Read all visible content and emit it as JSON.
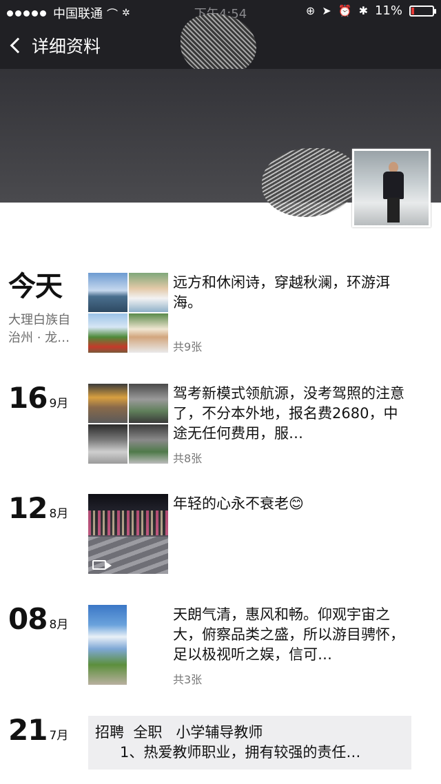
{
  "status_bar": {
    "carrier": "中国联通",
    "time": "下午4:54",
    "battery": "11%",
    "battery_level": 0.11
  },
  "nav": {
    "back_label": "详细资料"
  },
  "posts": [
    {
      "day": "今天",
      "month": "",
      "location": "大理白族自治州 · 龙…",
      "text": "远方和休闲诗，穿越秋澜，环游洱海。",
      "count": "共9张"
    },
    {
      "day": "16",
      "month": "9月",
      "text": "驾考新模式领航源，没考驾照的注意了，不分本外地，报名费2680，中途无任何费用，服…",
      "count": "共8张"
    },
    {
      "day": "12",
      "month": "8月",
      "text": "年轻的心永不衰老😊",
      "count": ""
    },
    {
      "day": "08",
      "month": "8月",
      "text": "天朗气清，惠风和畅。仰观宇宙之大，俯察品类之盛，所以游目骋怀，足以极视听之娱，信可…",
      "count": "共3张"
    },
    {
      "day": "21",
      "month": "7月",
      "share_line1": "招聘  全职   小学辅导教师",
      "share_line2": "1、热爱教师职业，拥有较强的责任…"
    }
  ]
}
